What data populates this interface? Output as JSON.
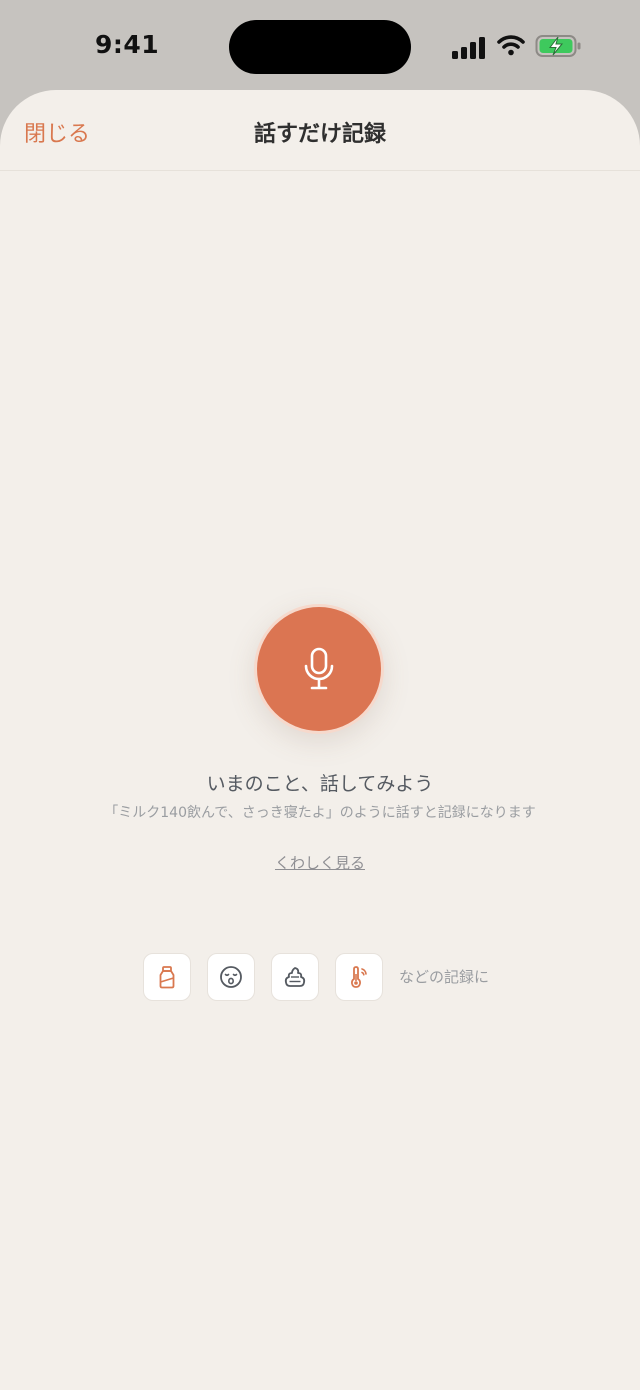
{
  "status_bar": {
    "time": "9:41"
  },
  "nav": {
    "close_label": "閉じる",
    "title": "話すだけ記録"
  },
  "main": {
    "mic_icon": "microphone-icon",
    "prompt": "いまのこと、話してみよう",
    "example": "「ミルク140飲んで、さっき寝たよ」のように話すと記録になります",
    "details_link": "くわしく見る"
  },
  "categories": {
    "icons": [
      "milk-bottle-icon",
      "sleeping-face-icon",
      "poop-icon",
      "thermometer-icon"
    ],
    "suffix": "などの記録に"
  },
  "colors": {
    "accent": "#db7552",
    "background": "#f3efea"
  }
}
